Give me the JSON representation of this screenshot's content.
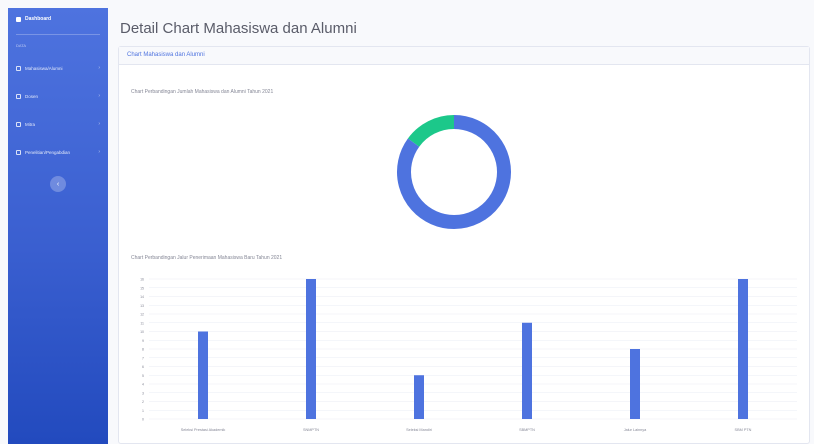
{
  "sidebar": {
    "brand": "Dashboard",
    "heading": "Data",
    "items": [
      {
        "label": "Mahasiswa/Alumni",
        "icon": "users-icon"
      },
      {
        "label": "Dosen",
        "icon": "chalkboard-icon"
      },
      {
        "label": "Mitra",
        "icon": "handshake-icon"
      },
      {
        "label": "Penelitian/Pengabdian",
        "icon": "book-icon"
      }
    ],
    "toggle": "‹"
  },
  "page_title": "Detail Chart Mahasiswa dan Alumni",
  "card": {
    "header": "Chart Mahasiswa dan Alumni"
  },
  "chart_data": [
    {
      "type": "pie",
      "title": "Chart Perbandingan Jumlah Mahasiswa dan Alumni Tahun 2021",
      "values": [
        85,
        15
      ],
      "colors": [
        "#4e73df",
        "#1cc88a"
      ]
    },
    {
      "type": "bar",
      "title": "Chart Perbandingan Jalur Penerimaan Mahasiswa Baru Tahun 2021",
      "categories": [
        "Seleksi Prestasi Akademik",
        "SNMPTN",
        "Seleksi Mandiri",
        "SBMPTN",
        "Jalur Lainnya",
        "SBM PTN"
      ],
      "values": [
        10,
        16,
        5,
        11,
        8,
        16
      ],
      "ylim": [
        0,
        16
      ],
      "yticks": [
        0,
        1,
        2,
        3,
        4,
        5,
        6,
        7,
        8,
        9,
        10,
        11,
        12,
        13,
        14,
        15,
        16
      ],
      "color": "#4e73df",
      "grid": true
    }
  ]
}
